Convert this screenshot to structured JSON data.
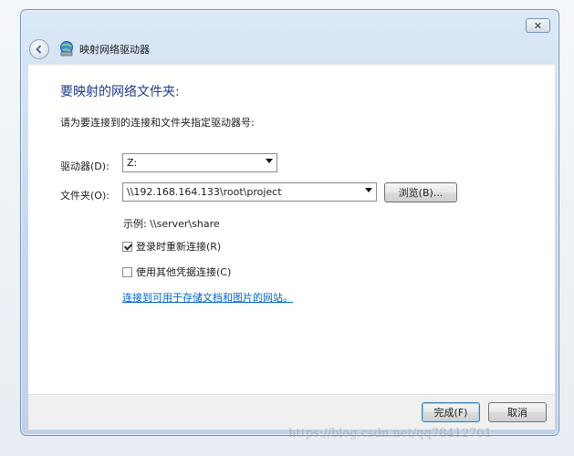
{
  "window": {
    "title": "映射网络驱动器",
    "close_glyph": "✕"
  },
  "icons": {
    "back": "back-arrow-icon",
    "network_drive": "network-drive-icon"
  },
  "content": {
    "heading": "要映射的网络文件夹:",
    "instruction": "请为要连接到的连接和文件夹指定驱动器号:",
    "drive_label": "驱动器(D):",
    "drive_value": "Z:",
    "folder_label": "文件夹(O):",
    "folder_value": "\\\\192.168.164.133\\root\\project",
    "browse_label": "浏览(B)...",
    "example": "示例: \\\\server\\share",
    "reconnect_label": "登录时重新连接(R)",
    "reconnect_checked": true,
    "other_credentials_label": "使用其他凭据连接(C)",
    "other_credentials_checked": false,
    "link": "连接到可用于存储文档和图片的网站。"
  },
  "footer": {
    "finish_label": "完成(F)",
    "cancel_label": "取消"
  },
  "watermark": "https://blog.csdn.net/qq78412701",
  "colors": {
    "heading": "#1e3a8a",
    "link": "#0066cc"
  }
}
